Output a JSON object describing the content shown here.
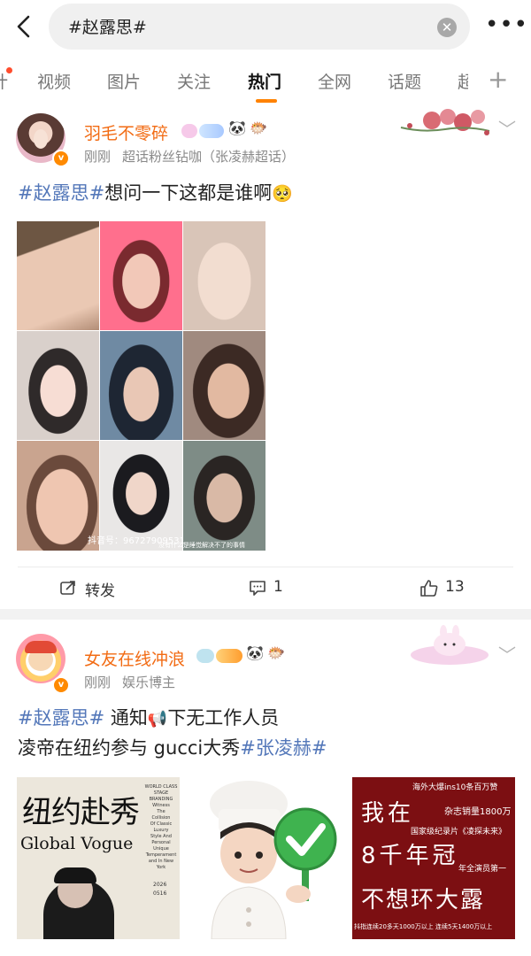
{
  "search": {
    "query": "#赵露思#"
  },
  "tabs": [
    {
      "label": "视频"
    },
    {
      "label": "图片"
    },
    {
      "label": "关注"
    },
    {
      "label": "热门"
    },
    {
      "label": "全网"
    },
    {
      "label": "话题"
    },
    {
      "label": "超"
    }
  ],
  "tab_prefix": "计",
  "active_tab": "热门",
  "posts": [
    {
      "username": "羽毛不零碎",
      "time": "刚刚",
      "source": "超话粉丝钻咖（张凌赫超话）",
      "text_tag": "#赵露思#",
      "text": "想问一下这都是谁啊",
      "emoji": "🥺",
      "watermark_id": "抖音号：96727909531",
      "watermark_caption": "没有什么是睡觉解决不了的事情",
      "actions": {
        "repost": "转发",
        "comment_count": "1",
        "like_count": "13"
      }
    },
    {
      "username": "女友在线冲浪",
      "time": "刚刚",
      "source": "娱乐博主",
      "text_tag": "#赵露思#",
      "text_line1_rest": " 通知",
      "text_line1_end": "下无工作人员",
      "text_line2": "凌帝在纽约参与 gucci大秀",
      "text_line2_tag": "#张凌赫#",
      "image1": {
        "title": "纽约赴秀",
        "brand": "Global Vogue",
        "side_text": [
          "WORLD CLASS",
          "STAGE",
          "BRANDING",
          "Witness",
          "The",
          "Collision",
          "Of Classic",
          "Luxury",
          "Style And",
          "Personal",
          "Unique",
          "Temperament",
          "and In New",
          "York"
        ],
        "date": "2026",
        "date2": "0516"
      },
      "image3": {
        "headline1": "我在",
        "headline2": "8千年冠",
        "headline3": "不想环大露",
        "top_note": "海外大爆ins10条百万赞",
        "note2": "杂志销量1800万",
        "note3": "国家级纪录片《凌探未来》",
        "note4": "年全演员第一",
        "footer": "抖指连续20多天1000万以上 连续5天1400万以上"
      }
    }
  ],
  "colors": {
    "accent": "#ff8200",
    "username": "#f26b13",
    "hashtag": "#5377b9",
    "meta": "#8a8a8a"
  }
}
